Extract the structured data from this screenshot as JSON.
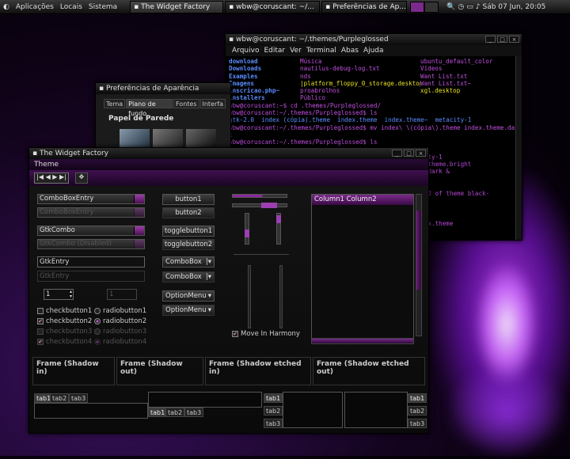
{
  "panel": {
    "menus": [
      "Aplicações",
      "Locais",
      "Sistema"
    ],
    "tasks": [
      "The Widget Factory",
      "wbw@coruscant: ~/...",
      "Preferências de Ap..."
    ],
    "clock": "Sáb 07 Jun, 20:05"
  },
  "terminal": {
    "title": "wbw@coruscant: ~/.themes/Purpleglossed",
    "menus": [
      "Arquivo",
      "Editar",
      "Ver",
      "Terminal",
      "Abas",
      "Ajuda"
    ],
    "lines": [
      {
        "cols": [
          "download",
          "Música",
          "",
          "ubuntu_default_color"
        ]
      },
      {
        "cols": [
          "Downloads",
          "nautilus-debug-log.txt",
          "",
          "Vídeos"
        ]
      },
      {
        "cols": [
          "Examples",
          "nds",
          "",
          "Want List.txt"
        ]
      },
      {
        "cols": [
          "Imagens",
          "|platform_floppy_0_storage.desktop",
          "",
          "Want List.txt~"
        ]
      },
      {
        "cols": [
          "inscricao.php~",
          "proabrolhos",
          "",
          "xgl.desktop"
        ]
      },
      {
        "cols": [
          "installers",
          "Público",
          "",
          ""
        ]
      },
      {
        "text": "wbw@coruscant:~$ cd .themes/Purpleglossed/"
      },
      {
        "text": "wbw@coruscant:~/.themes/Purpleglossed$ ls"
      },
      {
        "text": "gtk-2.0  index (cópia).theme  index.theme  index.theme~  metacity-1"
      },
      {
        "text": "wbw@coruscant:~/.themes/Purpleglossed$ mv index\\ \\(cópia\\).theme index.theme.dar"
      },
      {
        "text": "k"
      },
      {
        "text": "wbw@coruscant:~/.themes/Purpleglossed$ ls"
      },
      {
        "text": ""
      },
      {
        "text": "                                                 metacity-1"
      },
      {
        "text": "                                                 index.theme.bright"
      },
      {
        "text": "                                                 index.dark &"
      },
      {
        "text": ""
      },
      {
        "text": ""
      },
      {
        "text": "                                                 aces/22 of theme black-"
      },
      {
        "text": ""
      },
      {
        "text": ""
      },
      {
        "text": ""
      },
      {
        "text": "                                                 k index.theme"
      }
    ]
  },
  "pref": {
    "title": "Preferências de Aparência",
    "tabs": [
      "Tema",
      "Plano de fundo",
      "Fontes",
      "Interfa"
    ],
    "section": "Papel de Parede"
  },
  "wf": {
    "title": "The Widget Factory",
    "menu": "Theme",
    "combos": {
      "entry1": "ComboBoxEntry",
      "entry2": "ComboBoxEntry",
      "gtk1": "GtkCombo",
      "gtk2": "GtkCombo (Disabled)"
    },
    "entries": {
      "e1": "GtkEntry",
      "e2": "GtkEntry"
    },
    "spin": {
      "a": "1",
      "b": "1"
    },
    "checks": [
      "checkbutton1",
      "checkbutton2",
      "checkbutton3",
      "checkbutton4"
    ],
    "radios": [
      "radiobutton1",
      "radiobutton2",
      "radiobutton3",
      "radiobutton4"
    ],
    "buttons": {
      "b1": "button1",
      "b2": "button2",
      "t1": "togglebutton1",
      "t2": "togglebutton2",
      "cb1": "ComboBox",
      "cb2": "ComboBox",
      "om1": "OptionMenu",
      "om2": "OptionMenu"
    },
    "harmony": "Move In Harmony",
    "tree": "Column1  Column2",
    "frames": [
      "Frame (Shadow in)",
      "Frame (Shadow out)",
      "Frame (Shadow etched in)",
      "Frame (Shadow etched out)"
    ],
    "tabs": [
      "tab1",
      "tab2",
      "tab3"
    ]
  },
  "colors": {
    "accent": "#9b3fb0",
    "blue": "#5a8cff",
    "yellow": "#e8e020"
  }
}
